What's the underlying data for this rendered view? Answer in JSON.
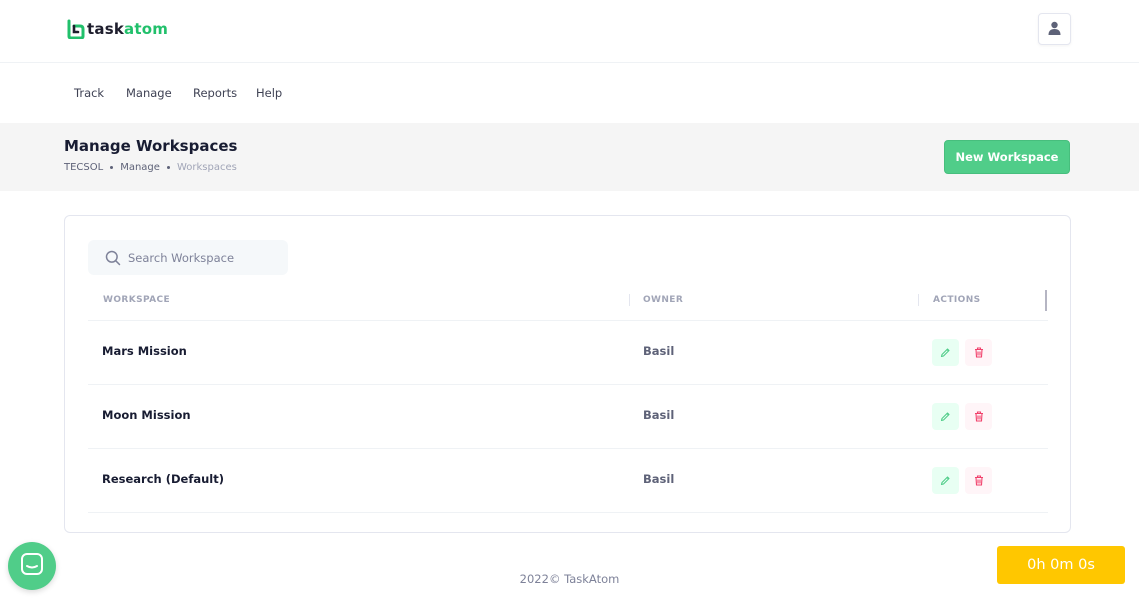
{
  "brand": {
    "name_dark": "task",
    "name_accent": "atom"
  },
  "header": {
    "user_menu_icon": "user-icon"
  },
  "nav": {
    "items": [
      {
        "label": "Track"
      },
      {
        "label": "Manage"
      },
      {
        "label": "Reports"
      },
      {
        "label": "Help"
      }
    ]
  },
  "toolbar": {
    "title": "Manage Workspaces",
    "breadcrumb": [
      "TECSOL",
      "Manage",
      "Workspaces"
    ],
    "new_button_label": "New Workspace"
  },
  "search": {
    "placeholder": "Search Workspace",
    "value": ""
  },
  "table": {
    "columns": [
      "WORKSPACE",
      "OWNER",
      "ACTIONS"
    ],
    "rows": [
      {
        "workspace": "Mars Mission",
        "owner": "Basil"
      },
      {
        "workspace": "Moon Mission",
        "owner": "Basil"
      },
      {
        "workspace": "Research (Default)",
        "owner": "Basil"
      }
    ]
  },
  "footer": {
    "text": "2022© TaskAtom"
  },
  "timer": {
    "text": "0h 0m 0s"
  },
  "colors": {
    "accent": "#50cd89",
    "brand": "#21c06b",
    "danger": "#f1416c",
    "timer": "#ffc700"
  }
}
